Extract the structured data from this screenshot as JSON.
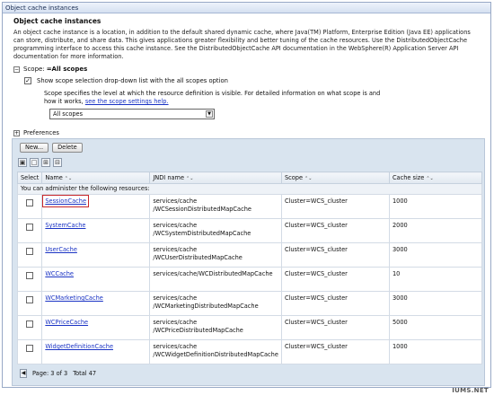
{
  "window": {
    "title": "Object cache instances"
  },
  "section": {
    "heading": "Object cache instances",
    "description": "An object cache instance is a location, in addition to the default shared dynamic cache, where Java(TM) Platform, Enterprise Edition (Java EE) applications can store, distribute, and share data. This gives applications greater flexibility and better tuning of the cache resources. Use the DistributedObjectCache programming interface to access this cache instance. See the DistributedObjectCache API documentation in the WebSphere(R) Application Server API documentation for more information."
  },
  "scope": {
    "label": "Scope:",
    "value": "=All scopes",
    "toggle_glyph": "−",
    "checkbox_label": "Show scope selection drop-down list with the all scopes option",
    "checkbox_checked": true,
    "help_text": "Scope specifies the level at which the resource definition is visible. For detailed information on what scope is and how it works,",
    "help_link": "see the scope settings help.",
    "select_value": "All scopes"
  },
  "preferences": {
    "label": "Preferences",
    "toggle_glyph": "+"
  },
  "toolbar": {
    "new_label": "New...",
    "delete_label": "Delete"
  },
  "table": {
    "columns": [
      "Select",
      "Name",
      "JNDI name",
      "Scope",
      "Cache size"
    ],
    "sort_glyph": "⌃⌄",
    "info_row": "You can administer the following resources:",
    "rows": [
      {
        "name": "SessionCache",
        "jndi1": "services/cache",
        "jndi2": "/WCSessionDistributedMapCache",
        "scope": "Cluster=WCS_cluster",
        "size": "1000"
      },
      {
        "name": "SystemCache",
        "jndi1": "services/cache",
        "jndi2": "/WCSystemDistributedMapCache",
        "scope": "Cluster=WCS_cluster",
        "size": "2000"
      },
      {
        "name": "UserCache",
        "jndi1": "services/cache",
        "jndi2": "/WCUserDistributedMapCache",
        "scope": "Cluster=WCS_cluster",
        "size": "3000"
      },
      {
        "name": "WCCache",
        "jndi1": "services/cache/WCDistributedMapCache",
        "jndi2": "",
        "scope": "Cluster=WCS_cluster",
        "size": "10"
      },
      {
        "name": "WCMarketingCache",
        "jndi1": "services/cache",
        "jndi2": "/WCMarketingDistributedMapCache",
        "scope": "Cluster=WCS_cluster",
        "size": "3000"
      },
      {
        "name": "WCPriceCache",
        "jndi1": "services/cache",
        "jndi2": "/WCPriceDistributedMapCache",
        "scope": "Cluster=WCS_cluster",
        "size": "5000"
      },
      {
        "name": "WidgetDefinitionCache",
        "jndi1": "services/cache",
        "jndi2": "/WCWidgetDefinitionDistributedMapCache",
        "scope": "Cluster=WCS_cluster",
        "size": "1000"
      }
    ]
  },
  "footer": {
    "page_label": "Page: 3 of 3",
    "total_label": "Total 47"
  },
  "watermark": "IUMS.NET",
  "colors": {
    "highlight": "#c8262a",
    "link": "#1a33c4",
    "panel": "#d9e4ef"
  }
}
